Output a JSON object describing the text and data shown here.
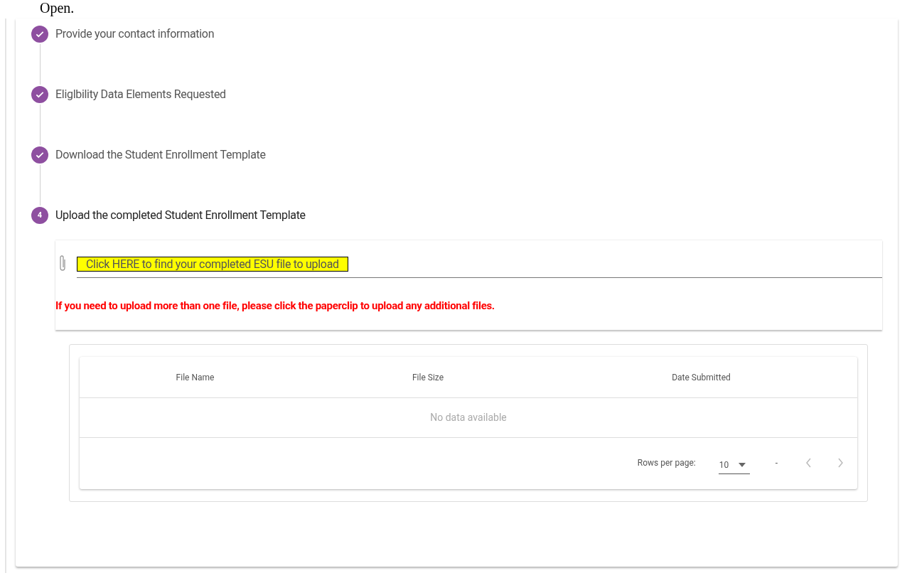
{
  "heading": "Open.",
  "steps": [
    {
      "label": "Provide your contact information",
      "completed": true
    },
    {
      "label": "Eliglbility Data Elements Requested",
      "completed": true
    },
    {
      "label": "Download the Student Enrollment Template",
      "completed": true
    },
    {
      "label": "Upload the completed Student Enrollment Template",
      "completed": false,
      "number": "4"
    }
  ],
  "upload": {
    "link": "Click HERE to find your completed ESU file to upload",
    "note": "If you need to upload more than one file, please click the paperclip to upload any additional files."
  },
  "table": {
    "columns": [
      "File Name",
      "File Size",
      "Date Submitted"
    ],
    "empty": "No data available",
    "rows_per_page_label": "Rows per page:",
    "rows_per_page": "10",
    "range": "-"
  }
}
